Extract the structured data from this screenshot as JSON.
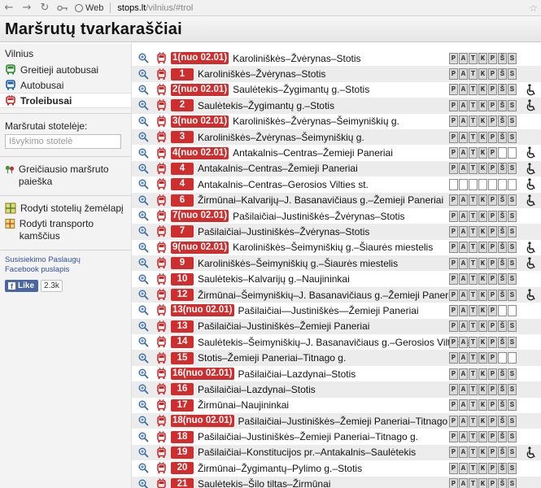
{
  "browser": {
    "back_icon": "back-arrow-icon",
    "forward_icon": "forward-arrow-icon",
    "reload_icon": "reload-icon",
    "key_icon": "key-icon",
    "web_label": "Web",
    "url_host": "stops.lt",
    "url_path": "/vilnius/#trol"
  },
  "page": {
    "title": "Maršrutų tvarkaraščiai"
  },
  "sidebar": {
    "city": "Vilnius",
    "transport": [
      {
        "label": "Greitieji autobusai",
        "icon": "bus-icon",
        "color": "#2e8b2e",
        "active": false
      },
      {
        "label": "Autobusai",
        "icon": "bus-icon",
        "color": "#1e5fa8",
        "active": false
      },
      {
        "label": "Troleibusai",
        "icon": "trolleybus-icon",
        "color": "#c82828",
        "active": true
      }
    ],
    "stop_search_label": "Maršrutai stotelėje:",
    "stop_search_placeholder": "Išvykimo stotelė",
    "route_search_label": "Greičiausio maršruto paieška",
    "map_link": "Rodyti stotelių žemėlapį",
    "traffic_link": "Rodyti transporto kamščius",
    "services_link": "Susisiekimo Paslaugų",
    "facebook_link": "Facebook puslapis",
    "like_label": "Like",
    "like_count": "2.3k"
  },
  "routes": [
    {
      "number": "1(nuo 02.01)",
      "name": "Karoliniškės–Žvėrynas–Stotis",
      "days": [
        "P",
        "A",
        "T",
        "K",
        "P",
        "Š",
        "S"
      ],
      "accessible": false
    },
    {
      "number": "1",
      "name": "Karoliniškės–Žvėrynas–Stotis",
      "days": [
        "P",
        "A",
        "T",
        "K",
        "P",
        "Š",
        "S"
      ],
      "accessible": false
    },
    {
      "number": "2(nuo 02.01)",
      "name": "Saulėtekis–Žygimantų g.–Stotis",
      "days": [
        "P",
        "A",
        "T",
        "K",
        "P",
        "Š",
        "S"
      ],
      "accessible": true
    },
    {
      "number": "2",
      "name": "Saulėtekis–Žygimantų g.–Stotis",
      "days": [
        "P",
        "A",
        "T",
        "K",
        "P",
        "Š",
        "S"
      ],
      "accessible": true
    },
    {
      "number": "3(nuo 02.01)",
      "name": "Karoliniškės–Žvėrynas–Šeimyniškių g.",
      "days": [
        "P",
        "A",
        "T",
        "K",
        "P",
        "Š",
        "S"
      ],
      "accessible": false
    },
    {
      "number": "3",
      "name": "Karoliniškės–Žvėrynas–Šeimyniškių g.",
      "days": [
        "P",
        "A",
        "T",
        "K",
        "P",
        "Š",
        "S"
      ],
      "accessible": false
    },
    {
      "number": "4(nuo 02.01)",
      "name": "Antakalnis–Centras–Žemieji Paneriai",
      "days": [
        "P",
        "A",
        "T",
        "K",
        "P",
        "",
        ""
      ],
      "accessible": true
    },
    {
      "number": "4",
      "name": "Antakalnis–Centras–Žemieji Paneriai",
      "days": [
        "P",
        "A",
        "T",
        "K",
        "P",
        "Š",
        "S"
      ],
      "accessible": true
    },
    {
      "number": "4",
      "name": "Antakalnis–Centras–Gerosios Vilties st.",
      "days": [
        "",
        "",
        "",
        "",
        "",
        "",
        ""
      ],
      "accessible": true
    },
    {
      "number": "6",
      "name": "Žirmūnai–Kalvarijų–J. Basanavičiaus g.–Žemieji Paneriai",
      "days": [
        "P",
        "A",
        "T",
        "K",
        "P",
        "Š",
        "S"
      ],
      "accessible": true
    },
    {
      "number": "7(nuo 02.01)",
      "name": "Pašilaičiai–Justiniškės–Žvėrynas–Stotis",
      "days": [
        "P",
        "A",
        "T",
        "K",
        "P",
        "Š",
        "S"
      ],
      "accessible": false
    },
    {
      "number": "7",
      "name": "Pašilaičiai–Justiniškės–Žvėrynas–Stotis",
      "days": [
        "P",
        "A",
        "T",
        "K",
        "P",
        "Š",
        "S"
      ],
      "accessible": false
    },
    {
      "number": "9(nuo 02.01)",
      "name": "Karoliniškės–Šeimyniškių g.–Šiaurės miestelis",
      "days": [
        "P",
        "A",
        "T",
        "K",
        "P",
        "Š",
        "S"
      ],
      "accessible": true
    },
    {
      "number": "9",
      "name": "Karoliniškės–Šeimyniškių g.–Šiaurės miestelis",
      "days": [
        "P",
        "A",
        "T",
        "K",
        "P",
        "Š",
        "S"
      ],
      "accessible": true
    },
    {
      "number": "10",
      "name": "Saulėtekis–Kalvarijų g.–Naujininkai",
      "days": [
        "P",
        "A",
        "T",
        "K",
        "P",
        "Š",
        "S"
      ],
      "accessible": false
    },
    {
      "number": "12",
      "name": "Žirmūnai–Šeimyniškių–J. Basanavičiaus g.–Žemieji Paneriai",
      "days": [
        "P",
        "A",
        "T",
        "K",
        "P",
        "Š",
        "S"
      ],
      "accessible": true
    },
    {
      "number": "13(nuo 02.01)",
      "name": "Pašilaičiai—Justiniškės—Žemieji Paneriai",
      "days": [
        "P",
        "A",
        "T",
        "K",
        "P",
        "",
        ""
      ],
      "accessible": false
    },
    {
      "number": "13",
      "name": "Pašilaičiai–Justiniškės–Žemieji Paneriai",
      "days": [
        "P",
        "A",
        "T",
        "K",
        "P",
        "Š",
        "S"
      ],
      "accessible": false
    },
    {
      "number": "14",
      "name": "Saulėtekis–Šeimyniškių–J. Basanavičiaus g.–Gerosios Vilties st.",
      "days": [
        "P",
        "A",
        "T",
        "K",
        "P",
        "Š",
        "S"
      ],
      "accessible": false
    },
    {
      "number": "15",
      "name": "Stotis–Žemieji Paneriai–Titnago g.",
      "days": [
        "P",
        "A",
        "T",
        "K",
        "P",
        "",
        ""
      ],
      "accessible": false
    },
    {
      "number": "16(nuo 02.01)",
      "name": "Pašilaičiai–Lazdynai–Stotis",
      "days": [
        "P",
        "A",
        "T",
        "K",
        "P",
        "Š",
        "S"
      ],
      "accessible": false
    },
    {
      "number": "16",
      "name": "Pašilaičiai–Lazdynai–Stotis",
      "days": [
        "P",
        "A",
        "T",
        "K",
        "P",
        "Š",
        "S"
      ],
      "accessible": false
    },
    {
      "number": "17",
      "name": "Žirmūnai–Naujininkai",
      "days": [
        "P",
        "A",
        "T",
        "K",
        "P",
        "Š",
        "S"
      ],
      "accessible": false
    },
    {
      "number": "18(nuo 02.01)",
      "name": "Pašilaičiai–Justiniškės–Žemieji Paneriai–Titnago g.",
      "days": [
        "P",
        "A",
        "T",
        "K",
        "P",
        "Š",
        "S"
      ],
      "accessible": false
    },
    {
      "number": "18",
      "name": "Pašilaičiai–Justiniškės–Žemieji Paneriai–Titnago g.",
      "days": [
        "P",
        "A",
        "T",
        "K",
        "P",
        "Š",
        "S"
      ],
      "accessible": false
    },
    {
      "number": "19",
      "name": "Pašilaičiai–Konstitucijos pr.–Antakalnis–Saulėtekis",
      "days": [
        "P",
        "A",
        "T",
        "K",
        "P",
        "Š",
        "S"
      ],
      "accessible": true
    },
    {
      "number": "20",
      "name": "Žirmūnai–Žygimantų–Pylimo g.–Stotis",
      "days": [
        "P",
        "A",
        "T",
        "K",
        "P",
        "Š",
        "S"
      ],
      "accessible": false
    },
    {
      "number": "21",
      "name": "Saulėtekis–Šilo tiltas–Žirmūnai",
      "days": [
        "P",
        "A",
        "T",
        "K",
        "P",
        "Š",
        "S"
      ],
      "accessible": false
    }
  ],
  "colors": {
    "badge": "#cf2e2e",
    "row_alt": "#ececec",
    "sidebar_bg": "#f3f3f3"
  }
}
